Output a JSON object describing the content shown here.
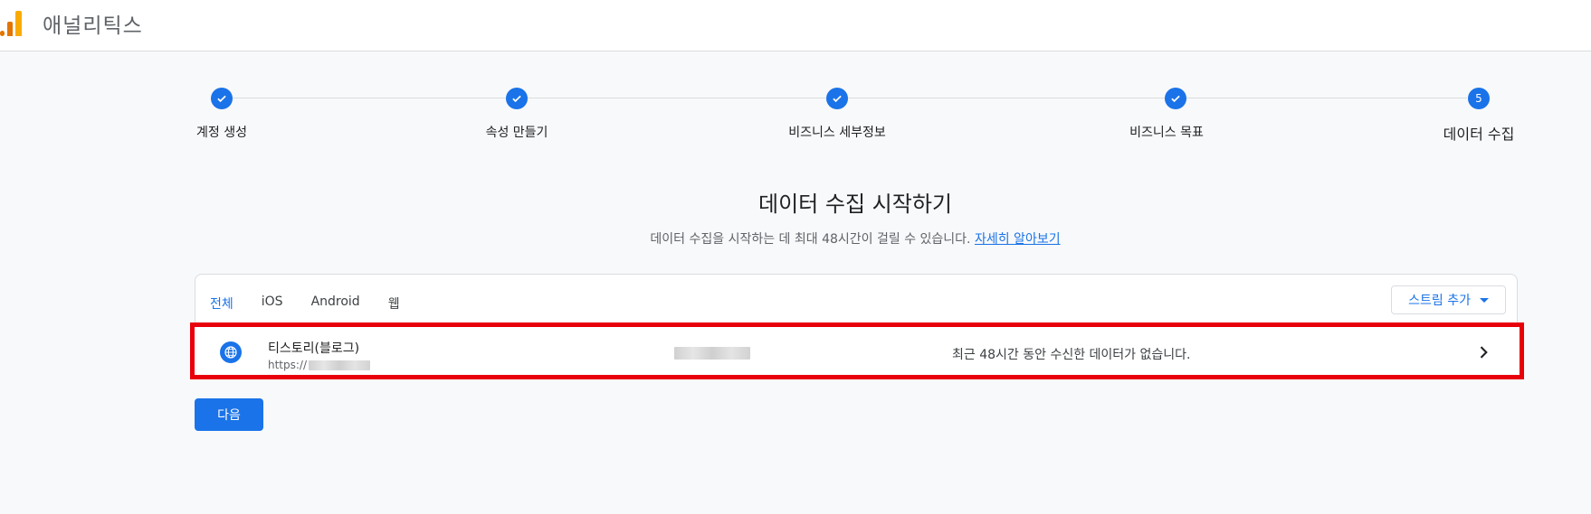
{
  "header": {
    "app_title": "애널리틱스"
  },
  "stepper": {
    "steps": [
      {
        "label": "계정 생성",
        "state": "complete"
      },
      {
        "label": "속성 만들기",
        "state": "complete"
      },
      {
        "label": "비즈니스 세부정보",
        "state": "complete"
      },
      {
        "label": "비즈니스 목표",
        "state": "complete"
      },
      {
        "label": "데이터 수집",
        "state": "current",
        "number": "5"
      }
    ]
  },
  "main": {
    "heading": "데이터 수집 시작하기",
    "subtext": "데이터 수집을 시작하는 데 최대 48시간이 걸릴 수 있습니다.",
    "learn_more": "자세히 알아보기"
  },
  "streams": {
    "tabs": [
      {
        "label": "전체",
        "active": true
      },
      {
        "label": "iOS",
        "active": false
      },
      {
        "label": "Android",
        "active": false
      },
      {
        "label": "웹",
        "active": false
      }
    ],
    "add_stream_label": "스트림 추가",
    "items": [
      {
        "name": "티스토리(블로그)",
        "url_prefix": "https://",
        "status": "최근 48시간 동안 수신한 데이터가 없습니다.",
        "icon": "globe-icon"
      }
    ]
  },
  "footer": {
    "next_label": "다음"
  },
  "colors": {
    "accent": "#1a73e8",
    "highlight": "#e8000b",
    "logo_orange": "#e37400",
    "logo_yellow": "#f9ab00"
  }
}
